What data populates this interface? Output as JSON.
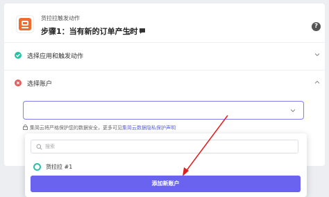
{
  "header": {
    "app_name": "货拉拉触发动作",
    "step_title": "步骤1：当有新的订单产生时"
  },
  "steps": [
    {
      "label": "选择应用和触发动作",
      "status": "done"
    },
    {
      "label": "选择账户",
      "status": "error"
    }
  ],
  "privacy": {
    "text": "集简云将严格保护您的数据安全，更多可见",
    "link": "集简云数据隐私保护声明"
  },
  "dropdown": {
    "search_placeholder": "搜索",
    "accounts": [
      {
        "name": "货拉拉 #1"
      }
    ],
    "add_button": "添加新账户"
  },
  "colors": {
    "accent": "#6a63f0",
    "success": "#27c2a5",
    "error": "#e85b5b",
    "annotation_arrow": "#e02020",
    "app_icon": "#f26a2c"
  },
  "icons": {
    "app": "truck-icon",
    "edit": "pencil-icon",
    "comment": "comment-icon",
    "help": "question-icon"
  }
}
